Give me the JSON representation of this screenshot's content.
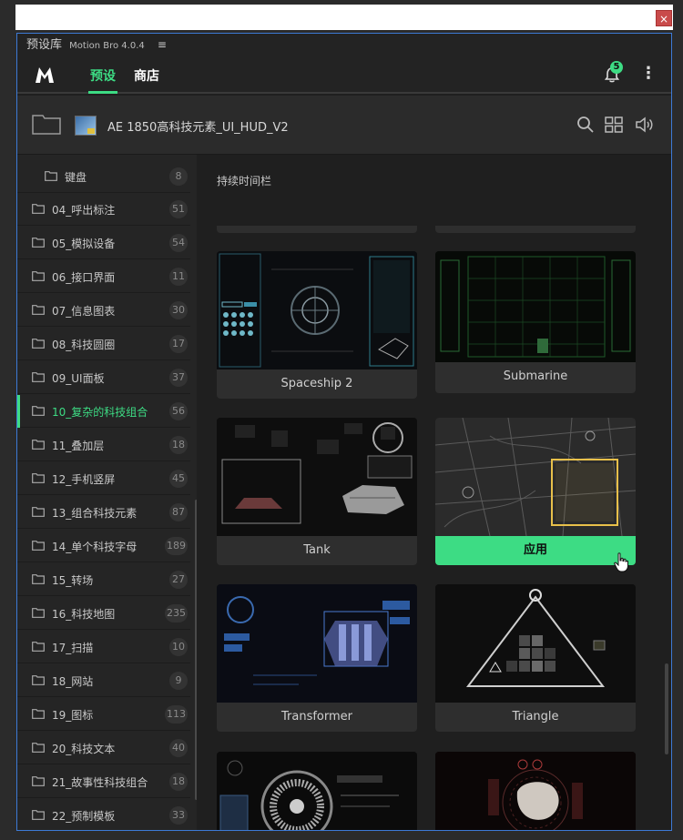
{
  "window": {
    "close_glyph": "×"
  },
  "panel": {
    "title": "预设库",
    "version": "Motion Bro 4.0.4",
    "menu_glyph": "≡"
  },
  "nav": {
    "tabs": [
      {
        "label": "预设",
        "active": true
      },
      {
        "label": "商店",
        "active": false
      }
    ],
    "notification_count": "5",
    "more_glyph": "⋮"
  },
  "path": {
    "title": "AE 1850高科技元素_UI_HUD_V2"
  },
  "sidebar": {
    "items": [
      {
        "label": "键盘",
        "count": "8",
        "sub": true
      },
      {
        "label": "04_呼出标注",
        "count": "51"
      },
      {
        "label": "05_模拟设备",
        "count": "54"
      },
      {
        "label": "06_接口界面",
        "count": "11"
      },
      {
        "label": "07_信息图表",
        "count": "30"
      },
      {
        "label": "08_科技圆圈",
        "count": "17"
      },
      {
        "label": "09_UI面板",
        "count": "37"
      },
      {
        "label": "10_复杂的科技组合",
        "count": "56",
        "active": true
      },
      {
        "label": "11_叠加层",
        "count": "18"
      },
      {
        "label": "12_手机竖屏",
        "count": "45"
      },
      {
        "label": "13_组合科技元素",
        "count": "87"
      },
      {
        "label": "14_单个科技字母",
        "count": "189"
      },
      {
        "label": "15_转场",
        "count": "27"
      },
      {
        "label": "16_科技地图",
        "count": "235"
      },
      {
        "label": "17_扫描",
        "count": "10"
      },
      {
        "label": "18_网站",
        "count": "9"
      },
      {
        "label": "19_图标",
        "count": "113"
      },
      {
        "label": "20_科技文本",
        "count": "40"
      },
      {
        "label": "21_故事性科技组合",
        "count": "18"
      },
      {
        "label": "22_预制模板",
        "count": "33"
      }
    ]
  },
  "content": {
    "section_title": "持续时间栏",
    "cards": [
      {
        "label": "Spaceship 2",
        "thumb": "spaceship-hud"
      },
      {
        "label": "Submarine",
        "thumb": "submarine-hud"
      },
      {
        "label": "Tank",
        "thumb": "tank-hud"
      },
      {
        "label": "应用",
        "thumb": "city-map-hud",
        "hover_apply": true
      },
      {
        "label": "Transformer",
        "thumb": "transformer-hud"
      },
      {
        "label": "Triangle",
        "thumb": "triangle-hud"
      },
      {
        "label": "",
        "thumb": "turbine-hud"
      },
      {
        "label": "",
        "thumb": "rock-hud"
      }
    ]
  },
  "colors": {
    "accent": "#3ddc84",
    "panel_border": "#3d7ad6",
    "close": "#c94b4b"
  }
}
